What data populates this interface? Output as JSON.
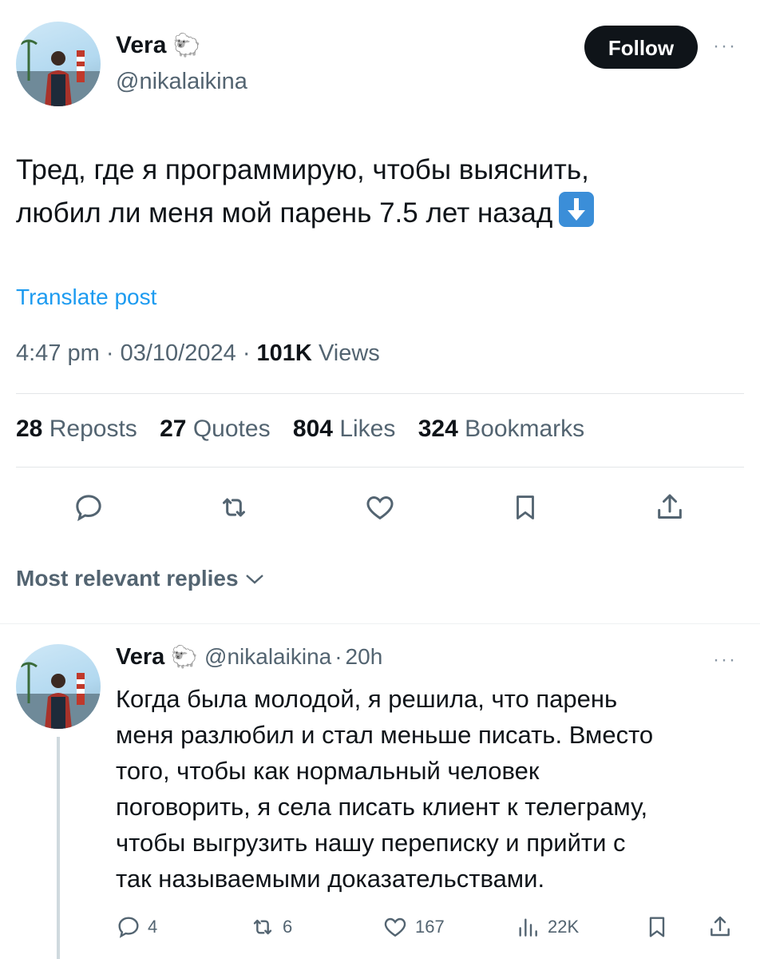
{
  "post": {
    "author_name": "Vera",
    "author_emoji": "🐑",
    "author_handle": "@nikalaikina",
    "follow_label": "Follow",
    "more_label": "···",
    "text_line1": "Тред, где я программирую, чтобы выяснить,",
    "text_line2": "любил ли меня мой парень 7.5 лет назад",
    "text_emoji_icon": "down-arrow-emoji",
    "translate_label": "Translate post",
    "time": "4:47 pm",
    "separator": "·",
    "date": "03/10/2024",
    "views_count": "101K",
    "views_label": "Views"
  },
  "stats": [
    {
      "count": "28",
      "label": "Reposts"
    },
    {
      "count": "27",
      "label": "Quotes"
    },
    {
      "count": "804",
      "label": "Likes"
    },
    {
      "count": "324",
      "label": "Bookmarks"
    }
  ],
  "actions": [
    "reply-icon",
    "repost-icon",
    "like-icon",
    "bookmark-icon",
    "share-icon"
  ],
  "replies_header": {
    "label": "Most relevant replies",
    "chevron": "⌄"
  },
  "reply": {
    "author_name": "Vera",
    "author_emoji": "🐑",
    "author_handle": "@nikalaikina",
    "separator": "·",
    "time": "20h",
    "more_label": "···",
    "lines": [
      "Когда была молодой, я решила, что парень",
      "меня разлюбил и стал меньше писать. Вместо",
      "того, чтобы как нормальный человек",
      "поговорить, я села писать клиент к телеграму,",
      "чтобы выгрузить нашу переписку и прийти с",
      "так называемыми доказательствами."
    ],
    "reply_count": "4",
    "repost_count": "6",
    "like_count": "167",
    "views_count": "22K"
  },
  "colors": {
    "link": "#1d9bf0",
    "muted": "#536471",
    "button": "#0f1419"
  }
}
